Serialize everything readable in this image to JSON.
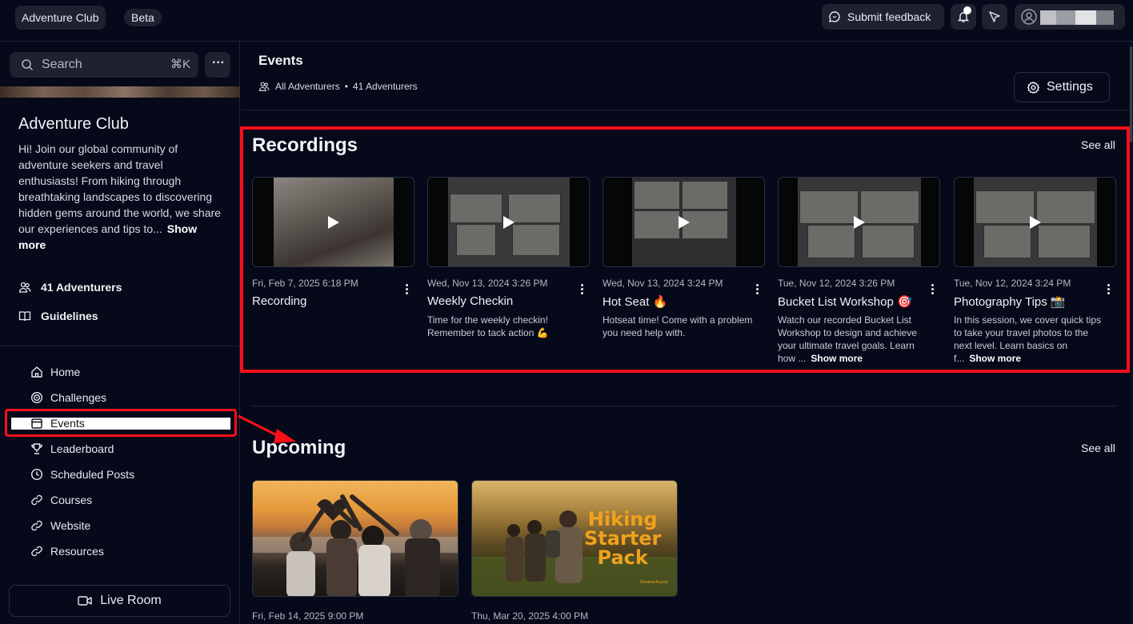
{
  "topbar": {
    "brand": "Adventure Club",
    "beta": "Beta",
    "feedback_label": "Submit feedback",
    "icons": [
      "bell-icon",
      "cursor-icon",
      "user-icon"
    ]
  },
  "sidebar": {
    "search_placeholder": "Search",
    "search_shortcut": "⌘K",
    "more_label": "···",
    "club_title": "Adventure Club",
    "club_description": "Hi! Join our global community of adventure seekers and travel enthusiasts! From hiking through breathtaking landscapes to discovering hidden gems around the world, we share our experiences and tips to...",
    "show_more": "Show more",
    "stats": [
      {
        "label": "41 Adventurers",
        "icon": "people-icon"
      },
      {
        "label": "Guidelines",
        "icon": "book-icon"
      }
    ],
    "nav": [
      {
        "label": "Home",
        "icon": "home-icon"
      },
      {
        "label": "Challenges",
        "icon": "target-icon"
      },
      {
        "label": "Events",
        "icon": "calendar-icon"
      },
      {
        "label": "Leaderboard",
        "icon": "trophy-icon"
      },
      {
        "label": "Scheduled Posts",
        "icon": "clock-icon"
      },
      {
        "label": "Courses",
        "icon": "link-icon"
      },
      {
        "label": "Website",
        "icon": "link-icon"
      },
      {
        "label": "Resources",
        "icon": "link-icon"
      }
    ],
    "live_room": "Live Room"
  },
  "header": {
    "title": "Events",
    "breadcrumb_group": "All Adventurers",
    "breadcrumb_count": "41 Adventurers",
    "breadcrumb_separator": "•",
    "settings_label": "Settings"
  },
  "recordings": {
    "title": "Recordings",
    "see_all": "See all",
    "items": [
      {
        "date": "Fri, Feb 7, 2025 6:18 PM",
        "title": "Recording",
        "desc": "",
        "more": ""
      },
      {
        "date": "Wed, Nov 13, 2024 3:26 PM",
        "title": "Weekly Checkin",
        "desc": "Time for the weekly checkin! Remember to tack action 💪",
        "more": ""
      },
      {
        "date": "Wed, Nov 13, 2024 3:24 PM",
        "title": "Hot Seat 🔥",
        "desc": "Hotseat time! Come with a problem you need help with.",
        "more": ""
      },
      {
        "date": "Tue, Nov 12, 2024 3:26 PM",
        "title": "Bucket List Workshop 🎯",
        "desc": "Watch our recorded Bucket List Workshop to design and achieve your ultimate travel goals. Learn how ...",
        "more": "Show more"
      },
      {
        "date": "Tue, Nov 12, 2024 3:24 PM",
        "title": "Photography Tips 📸",
        "desc": "In this session, we cover quick tips to take your travel photos to the next level. Learn basics on f...",
        "more": "Show more"
      }
    ]
  },
  "upcoming": {
    "title": "Upcoming",
    "see_all": "See all",
    "items": [
      {
        "date": "Fri, Feb 14, 2025 9:00 PM",
        "image": "friends-sunset-photo"
      },
      {
        "date": "Thu, Mar 20, 2025 4:00 PM",
        "image": "hiking-starter-pack-photo",
        "overlay_line1": "Hiking",
        "overlay_line2": "Starter",
        "overlay_line3": "Pack",
        "overlay_small": "General Access"
      }
    ]
  },
  "colors": {
    "background": "#05091a",
    "panel": "#1e2230",
    "highlight": "#ff0d1a",
    "overlay_text": "#f0a21c"
  }
}
